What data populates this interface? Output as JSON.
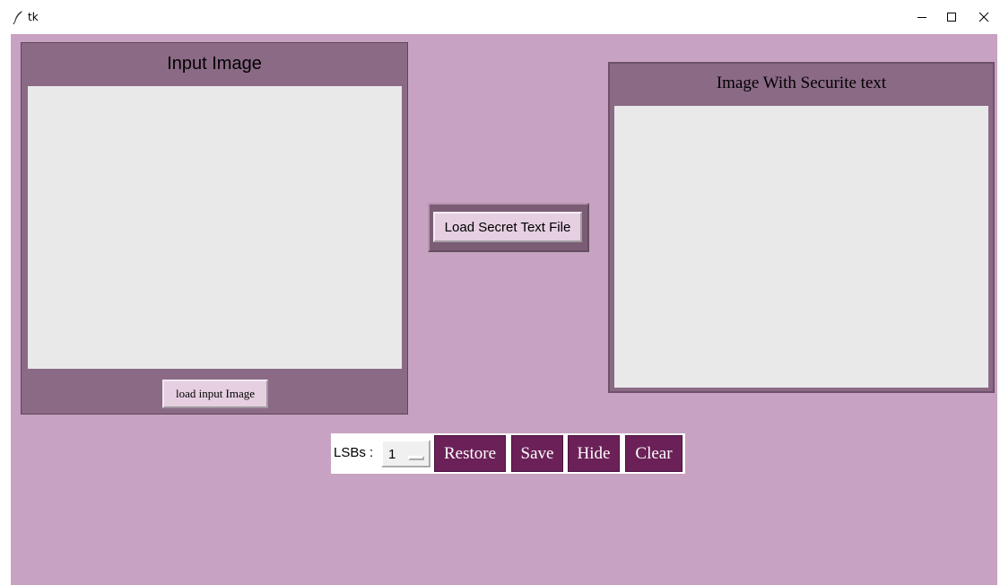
{
  "window": {
    "title": "tk"
  },
  "left_panel": {
    "title": "Input Image",
    "load_button": "load input Image"
  },
  "middle": {
    "load_secret_button": "Load Secret Text File"
  },
  "right_panel": {
    "title": "Image With Securite text"
  },
  "controls": {
    "lsb_label": "LSBs :",
    "lsb_value": "1",
    "restore": "Restore",
    "save": "Save",
    "hide": "Hide",
    "clear": "Clear"
  },
  "colors": {
    "background": "#c8a2c2",
    "panel": "#8b6a86",
    "canvas": "#e9e9e9",
    "action_button": "#6b2157"
  }
}
